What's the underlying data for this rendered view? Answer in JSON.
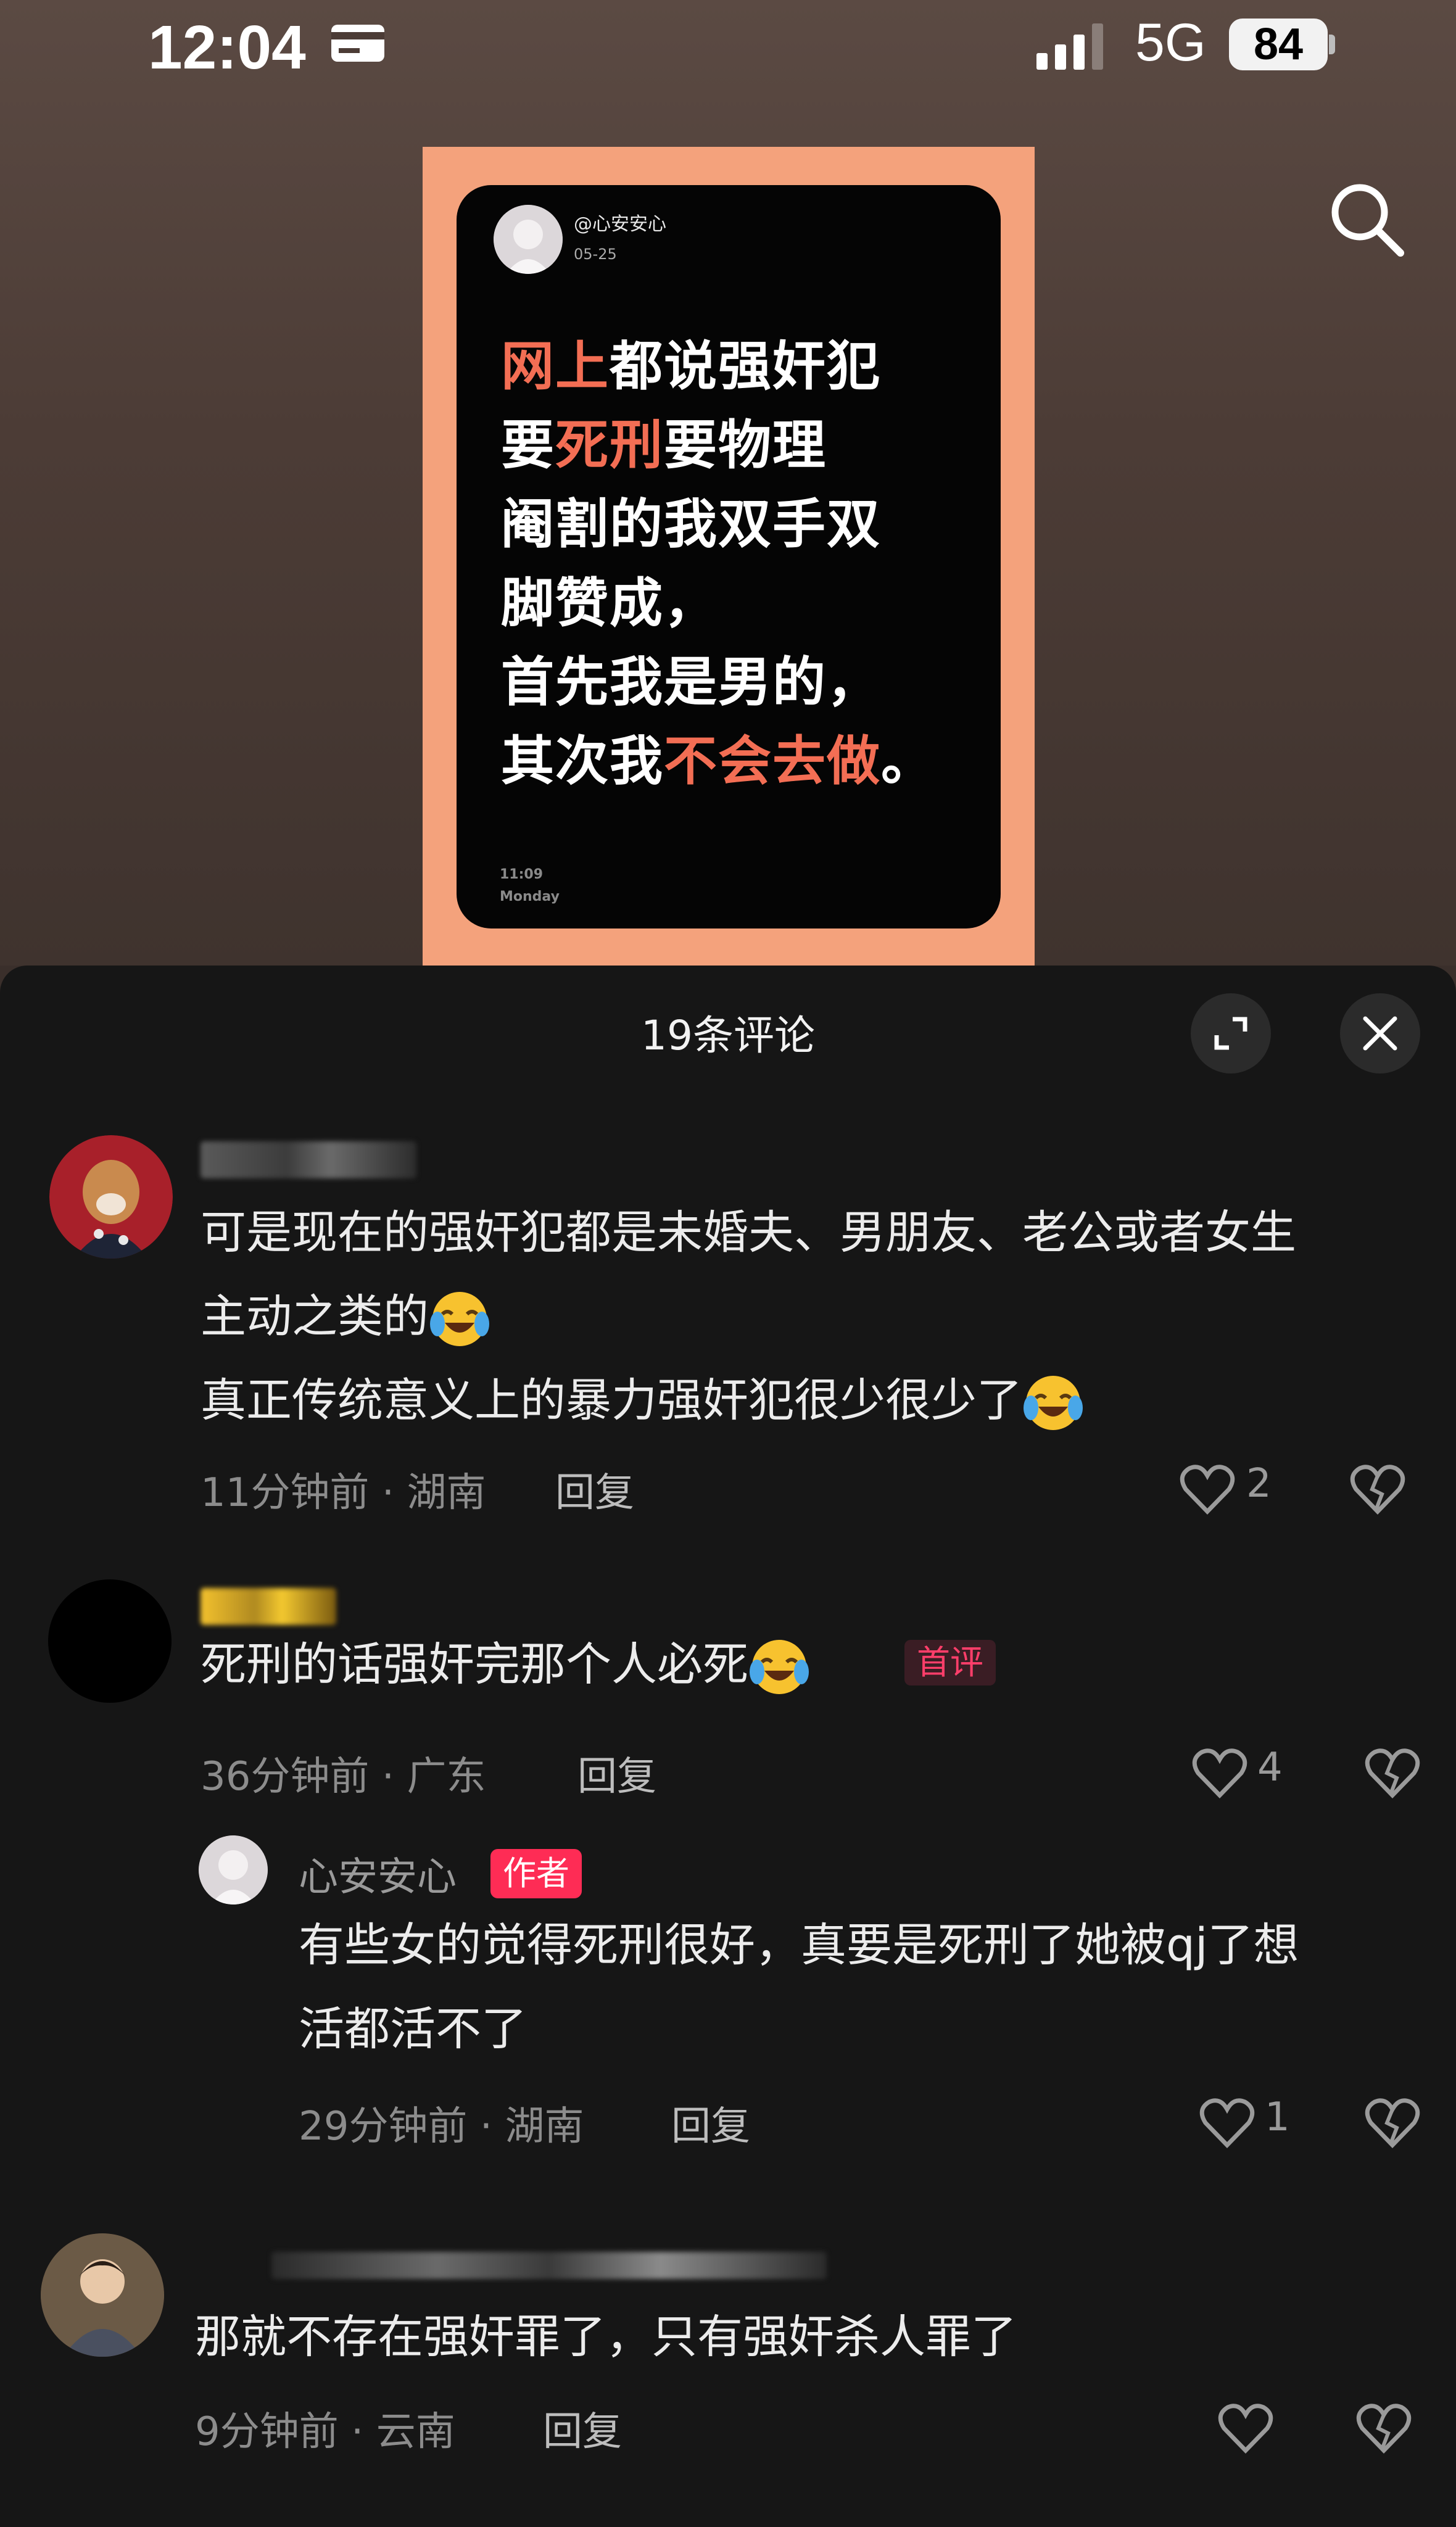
{
  "status": {
    "time": "12:04",
    "network": "5G",
    "battery": "84"
  },
  "poster": {
    "username": "@心安安心",
    "date": "05-25",
    "line1_hl": "网上",
    "line1_rest": "都说强奸犯",
    "line2_a": "要",
    "line2_hl": "死刑",
    "line2_b": "要物理",
    "line3": "阉割的我双手双",
    "line4": "脚赞成，",
    "line5": "首先我是男的，",
    "line6_a": "其次我",
    "line6_hl": "不会去做",
    "line6_b": "。",
    "foot_time": "11:09",
    "foot_day": "Monday"
  },
  "sheet": {
    "title": "19条评论"
  },
  "comments": [
    {
      "text_line1": "可是现在的强奸犯都是未婚夫、男朋友、老公或者女生",
      "text_line2": "主动之类的",
      "text_line3": "真正传统意义上的暴力强奸犯很少很少了",
      "meta": "11分钟前 · 湖南",
      "reply": "回复",
      "likes": "2"
    },
    {
      "text": "死刑的话强奸完那个人必死",
      "badge": "首评",
      "meta": "36分钟前 · 广东",
      "reply": "回复",
      "likes": "4"
    },
    {
      "name": "心安安心",
      "badge": "作者",
      "text_line1": "有些女的觉得死刑很好，真要是死刑了她被qj了想",
      "text_line2": "活都活不了",
      "meta": "29分钟前 · 湖南",
      "reply": "回复",
      "likes": "1"
    },
    {
      "text": "那就不存在强奸罪了，只有强奸杀人罪了",
      "meta": "9分钟前 · 云南",
      "reply": "回复"
    }
  ],
  "colors": {
    "accent": "#fe2c55",
    "poster_bg": "#f4a27c",
    "highlight": "#f36e54"
  },
  "icons": [
    "card-icon",
    "signal-icon",
    "search-icon",
    "expand-icon",
    "close-icon",
    "heart-icon",
    "broken-heart-icon",
    "tears-of-joy-emoji"
  ]
}
